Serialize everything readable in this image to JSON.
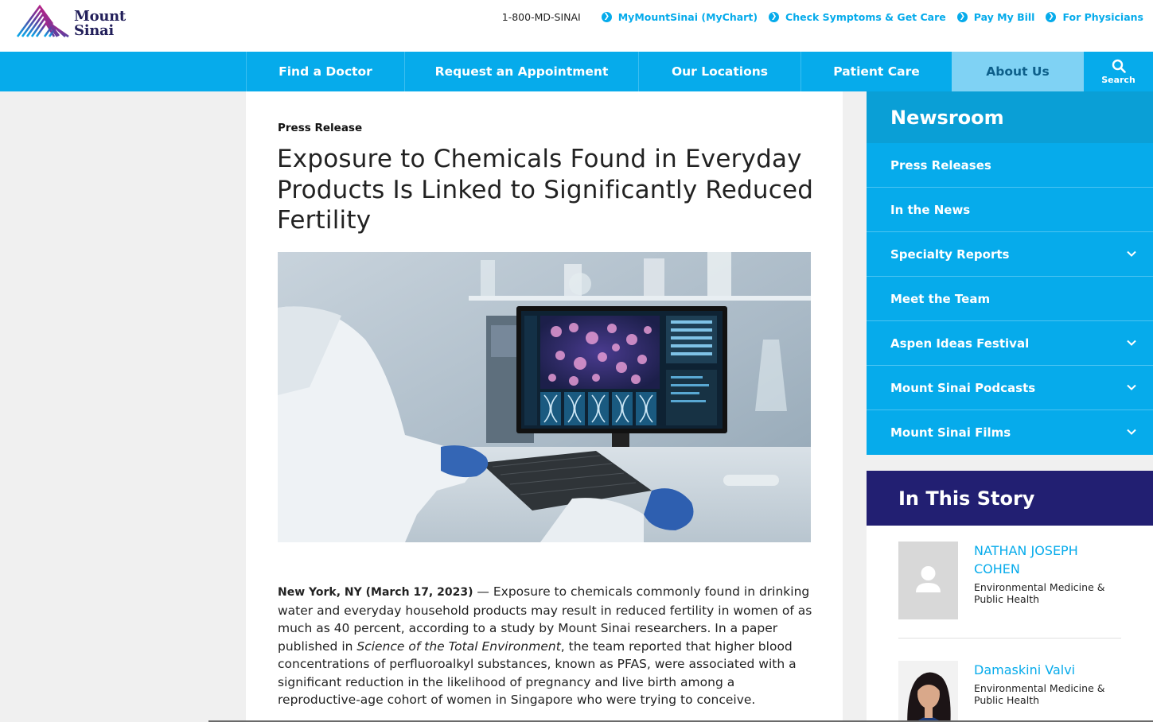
{
  "header": {
    "logo_text_line1": "Mount",
    "logo_text_line2": "Sinai",
    "phone": "1-800-MD-SINAI",
    "utility_links": [
      "MyMountSinai (MyChart)",
      "Check Symptoms & Get Care",
      "Pay My Bill",
      "For Physicians"
    ]
  },
  "nav": {
    "items": [
      "Find a Doctor",
      "Request an Appointment",
      "Our Locations",
      "Patient Care",
      "About Us"
    ],
    "active": "About Us",
    "search_label": "Search"
  },
  "article": {
    "eyebrow": "Press Release",
    "title": "Exposure to Chemicals Found in Everyday Products Is Linked to Significantly Reduced Fertility",
    "dateline": "New York, NY (March 17, 2023)",
    "body_part1": " — Exposure to chemicals commonly found in drinking water and everyday household products may result in reduced fertility in women of as much as 40 percent, according to a study by Mount Sinai researchers. In a paper published in ",
    "journal": "Science of the Total Environment",
    "body_part2": ", the team reported that higher blood concentrations of perfluoroalkyl substances, known as PFAS, were associated with a significant reduction in the likelihood of pregnancy and live birth among a reproductive-age cohort of women in Singapore who were trying to conceive."
  },
  "sidebar": {
    "newsroom_title": "Newsroom",
    "items": [
      {
        "label": "Press Releases",
        "expandable": false
      },
      {
        "label": "In the News",
        "expandable": false
      },
      {
        "label": "Specialty Reports",
        "expandable": true
      },
      {
        "label": "Meet the Team",
        "expandable": false
      },
      {
        "label": "Aspen Ideas Festival",
        "expandable": true
      },
      {
        "label": "Mount Sinai Podcasts",
        "expandable": true
      },
      {
        "label": "Mount Sinai Films",
        "expandable": true
      }
    ],
    "story_title": "In This Story",
    "people": [
      {
        "name": "NATHAN JOSEPH COHEN",
        "dept": "Environmental Medicine & Public Health"
      },
      {
        "name": "Damaskini Valvi",
        "dept": "Environmental Medicine & Public Health"
      }
    ]
  },
  "colors": {
    "brand_blue": "#06abeb",
    "brand_navy": "#221f72",
    "active_tab": "#7fd2f4"
  }
}
